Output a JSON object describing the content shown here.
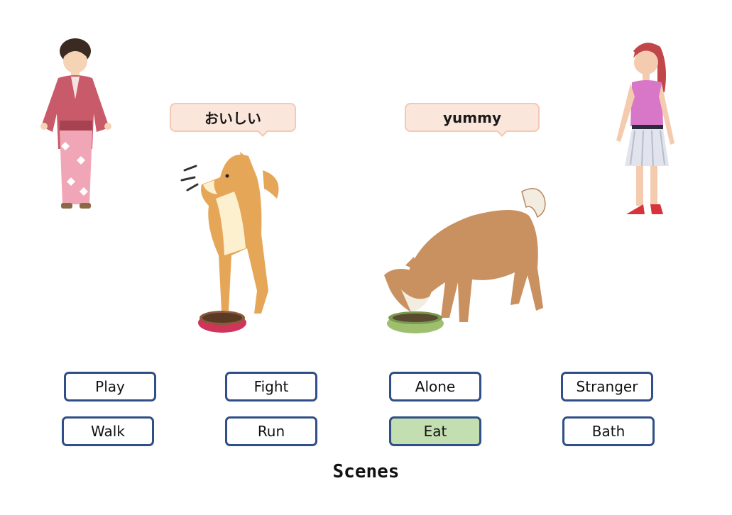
{
  "bubbles": {
    "left": "おいしい",
    "right": "yummy"
  },
  "choices": {
    "row1": [
      "Play",
      "Fight",
      "Alone",
      "Stranger"
    ],
    "row2": [
      "Walk",
      "Run",
      "Eat",
      "Bath"
    ],
    "selected": "Eat"
  },
  "footer": {
    "title": "Scenes"
  },
  "colors": {
    "button_border": "#2f4f86",
    "button_selected": "#c3deb0",
    "bubble_fill": "#fbe6dc",
    "bubble_border": "#f3c9b3"
  },
  "icons": {
    "left_person": "kimono-woman-icon",
    "right_person": "girl-icon",
    "left_dog": "shiba-dog-looking-up-icon",
    "right_dog": "shiba-dog-eating-icon"
  }
}
